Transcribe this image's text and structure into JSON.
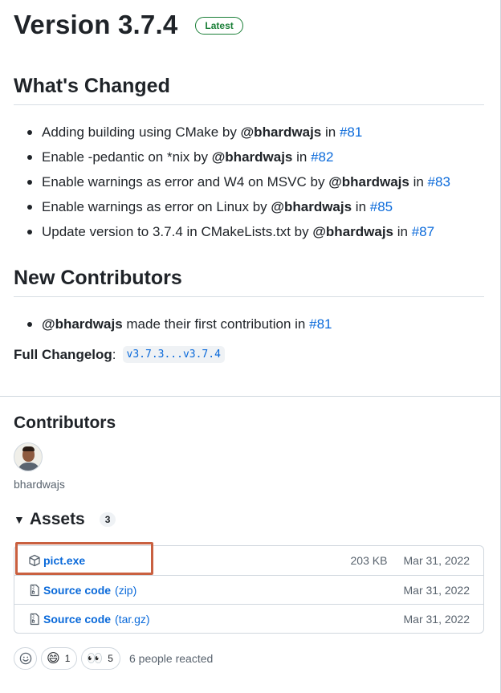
{
  "release": {
    "title": "Version 3.7.4",
    "badge": "Latest"
  },
  "whats_changed": {
    "heading": "What's Changed",
    "items": [
      {
        "text": "Adding building using CMake by",
        "mention": "@bhardwajs",
        "in": "in",
        "pr": "#81"
      },
      {
        "text": "Enable -pedantic on *nix by",
        "mention": "@bhardwajs",
        "in": "in",
        "pr": "#82"
      },
      {
        "text": "Enable warnings as error and W4 on MSVC by",
        "mention": "@bhardwajs",
        "in": "in",
        "pr": "#83"
      },
      {
        "text": "Enable warnings as error on Linux by",
        "mention": "@bhardwajs",
        "in": "in",
        "pr": "#85"
      },
      {
        "text": "Update version to 3.7.4 in CMakeLists.txt by",
        "mention": "@bhardwajs",
        "in": "in",
        "pr": "#87"
      }
    ]
  },
  "new_contributors": {
    "heading": "New Contributors",
    "items": [
      {
        "mention": "@bhardwajs",
        "text": "made their first contribution in",
        "pr": "#81"
      }
    ]
  },
  "full_changelog": {
    "label": "Full Changelog",
    "colon": ":",
    "range": "v3.7.3...v3.7.4"
  },
  "contributors": {
    "heading": "Contributors",
    "names": [
      "bhardwajs"
    ]
  },
  "assets": {
    "heading": "Assets",
    "count": "3",
    "items": [
      {
        "name": "pict.exe",
        "suffix": "",
        "size": "203 KB",
        "date": "Mar 31, 2022",
        "icon": "package-icon"
      },
      {
        "name": "Source code",
        "suffix": "(zip)",
        "size": "",
        "date": "Mar 31, 2022",
        "icon": "file-zip-icon"
      },
      {
        "name": "Source code",
        "suffix": "(tar.gz)",
        "size": "",
        "date": "Mar 31, 2022",
        "icon": "file-zip-icon"
      }
    ]
  },
  "reactions": {
    "items": [
      {
        "emoji": "😄",
        "count": "1"
      },
      {
        "emoji": "👀",
        "count": "5"
      }
    ],
    "summary": "6 people reacted"
  },
  "colors": {
    "link": "#0969da",
    "badge_green": "#1a7f37",
    "highlight": "#c96040"
  }
}
